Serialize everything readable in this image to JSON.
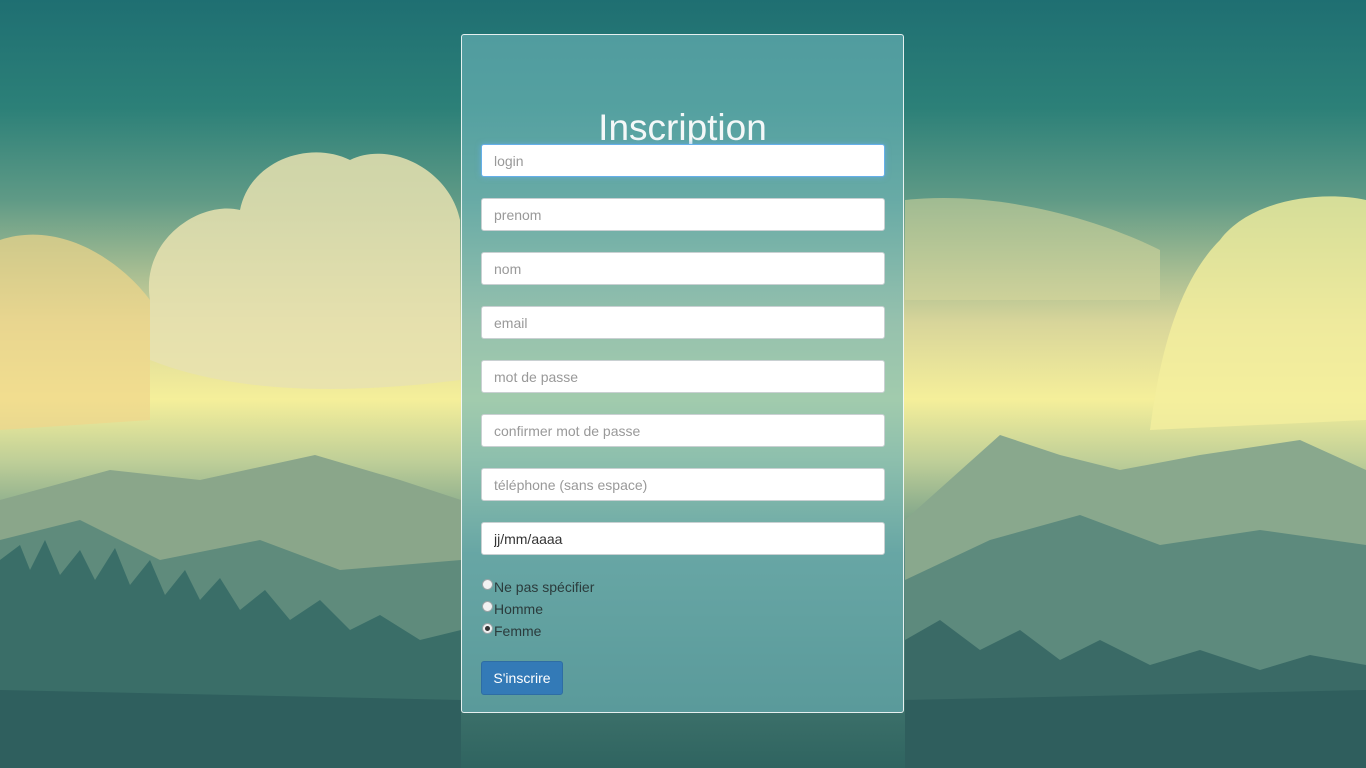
{
  "form": {
    "title": "Inscription",
    "fields": [
      {
        "placeholder": "login"
      },
      {
        "placeholder": "prenom"
      },
      {
        "placeholder": "nom"
      },
      {
        "placeholder": "email"
      },
      {
        "placeholder": "mot de passe"
      },
      {
        "placeholder": "confirmer mot de passe"
      },
      {
        "placeholder": "téléphone (sans espace)"
      },
      {
        "value": "jj/mm/aaaa"
      }
    ],
    "gender_options": [
      {
        "label": "Ne pas spécifier",
        "checked": false
      },
      {
        "label": "Homme",
        "checked": false
      },
      {
        "label": "Femme",
        "checked": true
      }
    ],
    "submit_label": "S'inscrire"
  },
  "colors": {
    "button": "#337ab7",
    "panel": "#6eb4b9"
  }
}
